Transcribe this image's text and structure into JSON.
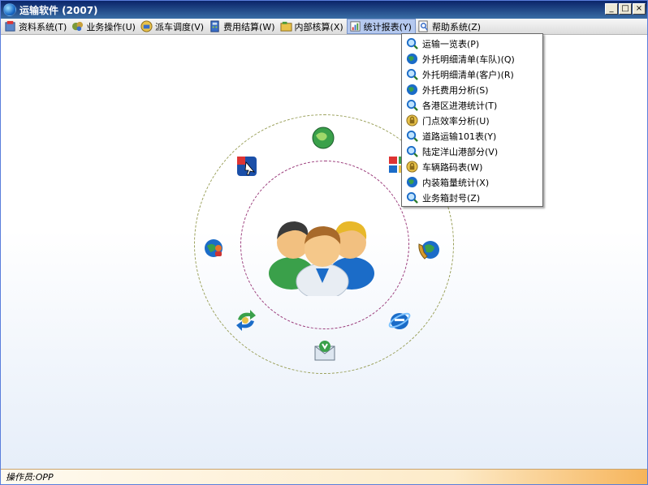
{
  "window": {
    "title": "运输软件 (2007)",
    "buttons": {
      "minimize": "_",
      "maximize": "□",
      "close": "×"
    }
  },
  "menubar": {
    "items": [
      {
        "label": "资料系统(T)",
        "icon": "database-icon"
      },
      {
        "label": "业务操作(U)",
        "icon": "gears-icon"
      },
      {
        "label": "派车调度(V)",
        "icon": "dispatch-icon"
      },
      {
        "label": "费用结算(W)",
        "icon": "calculator-icon"
      },
      {
        "label": "内部核算(X)",
        "icon": "folder-icon"
      },
      {
        "label": "统计报表(Y)",
        "icon": "report-icon"
      },
      {
        "label": "帮助系统(Z)",
        "icon": "help-icon"
      }
    ]
  },
  "dropdown": {
    "items": [
      {
        "label": "运输一览表(P)",
        "icon": "magnifier-icon"
      },
      {
        "label": "外托明细清单(车队)(Q)",
        "icon": "globe-icon"
      },
      {
        "label": "外托明细清单(客户)(R)",
        "icon": "magnifier-icon"
      },
      {
        "label": "外托费用分析(S)",
        "icon": "globe-icon"
      },
      {
        "label": "各港区进港统计(T)",
        "icon": "magnifier-icon"
      },
      {
        "label": "门点效率分析(U)",
        "icon": "lock-icon"
      },
      {
        "label": "道路运输101表(Y)",
        "icon": "magnifier-icon"
      },
      {
        "label": "陆定洋山港部分(V)",
        "icon": "magnifier-icon"
      },
      {
        "label": "车辆路码表(W)",
        "icon": "lock-icon"
      },
      {
        "label": "内装箱量统计(X)",
        "icon": "globe-icon"
      },
      {
        "label": "业务箱封号(Z)",
        "icon": "magnifier-icon"
      }
    ]
  },
  "statusbar": {
    "text": "操作员:OPP"
  },
  "colors": {
    "titlebar": "#0a246a",
    "menu_active": "#b5c9ef",
    "status_accent": "#f6b45a"
  }
}
